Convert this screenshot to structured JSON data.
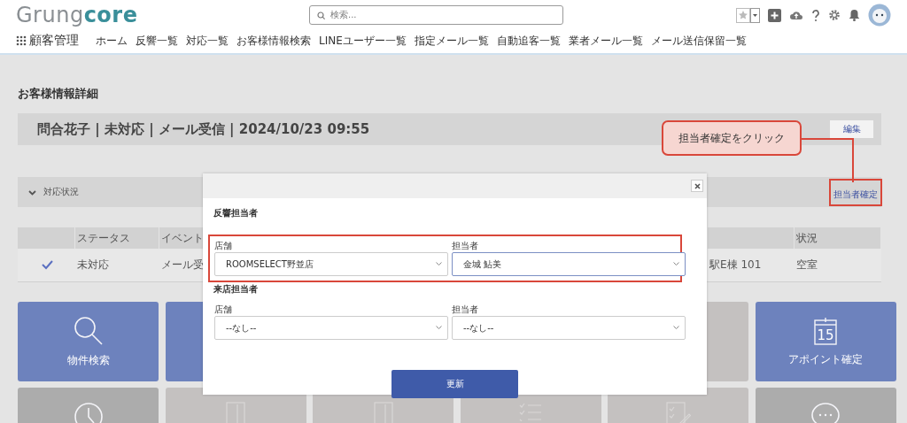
{
  "header": {
    "logo": {
      "first": "Grung",
      "second": "core"
    },
    "search": {
      "placeholder": "検索..."
    },
    "app_name": "顧客管理",
    "nav": [
      "ホーム",
      "反響一覧",
      "対応一覧",
      "お客様情報検索",
      "LINEユーザー一覧",
      "指定メール一覧",
      "自動追客一覧",
      "業者メール一覧",
      "メール送信保留一覧"
    ]
  },
  "page_title": "お客様情報詳細",
  "summary": {
    "text": "問合花子 | 未対応 | メール受信 | 2024/10/23 09:55",
    "edit_button": "編集"
  },
  "section": {
    "title": "対応状況",
    "expanded": true,
    "action": "担当者確定"
  },
  "table": {
    "columns": [
      "ステータス",
      "イベント",
      "",
      "状況"
    ],
    "rows": [
      {
        "checked": true,
        "cells": [
          "未対応",
          "メール受",
          "駅E棟 101",
          "空室"
        ]
      }
    ]
  },
  "tiles": [
    {
      "kind": "search",
      "label": "物件検索",
      "color": "#6d82bd"
    },
    {
      "kind": "blank",
      "color": "#6d82bd"
    },
    {
      "kind": "covered"
    },
    {
      "kind": "covered"
    },
    {
      "kind": "blank",
      "color": "#c4c1c0"
    },
    {
      "kind": "calendar",
      "label": "アポイント確定",
      "color": "#6d82bd",
      "day": "15"
    },
    {
      "kind": "clock",
      "color": "#acacac"
    },
    {
      "kind": "door",
      "color": "#c4c1c0"
    },
    {
      "kind": "door",
      "color": "#c4c1c0"
    },
    {
      "kind": "checklist",
      "color": "#c4c1c0"
    },
    {
      "kind": "edit",
      "color": "#c4c1c0"
    },
    {
      "kind": "chat",
      "color": "#acacac"
    }
  ],
  "modal": {
    "sections": [
      {
        "title": "反響担当者",
        "highlighted": true,
        "fields": [
          {
            "label": "店舗",
            "value": "ROOMSELECT野並店",
            "focused": false
          },
          {
            "label": "担当者",
            "value": "金城 鮎美",
            "focused": true
          }
        ]
      },
      {
        "title": "来店担当者",
        "highlighted": false,
        "fields": [
          {
            "label": "店舗",
            "value": "--なし--",
            "focused": false
          },
          {
            "label": "担当者",
            "value": "--なし--",
            "focused": false
          }
        ]
      }
    ],
    "submit": "更新"
  },
  "callout": {
    "text": "担当者確定をクリック"
  }
}
